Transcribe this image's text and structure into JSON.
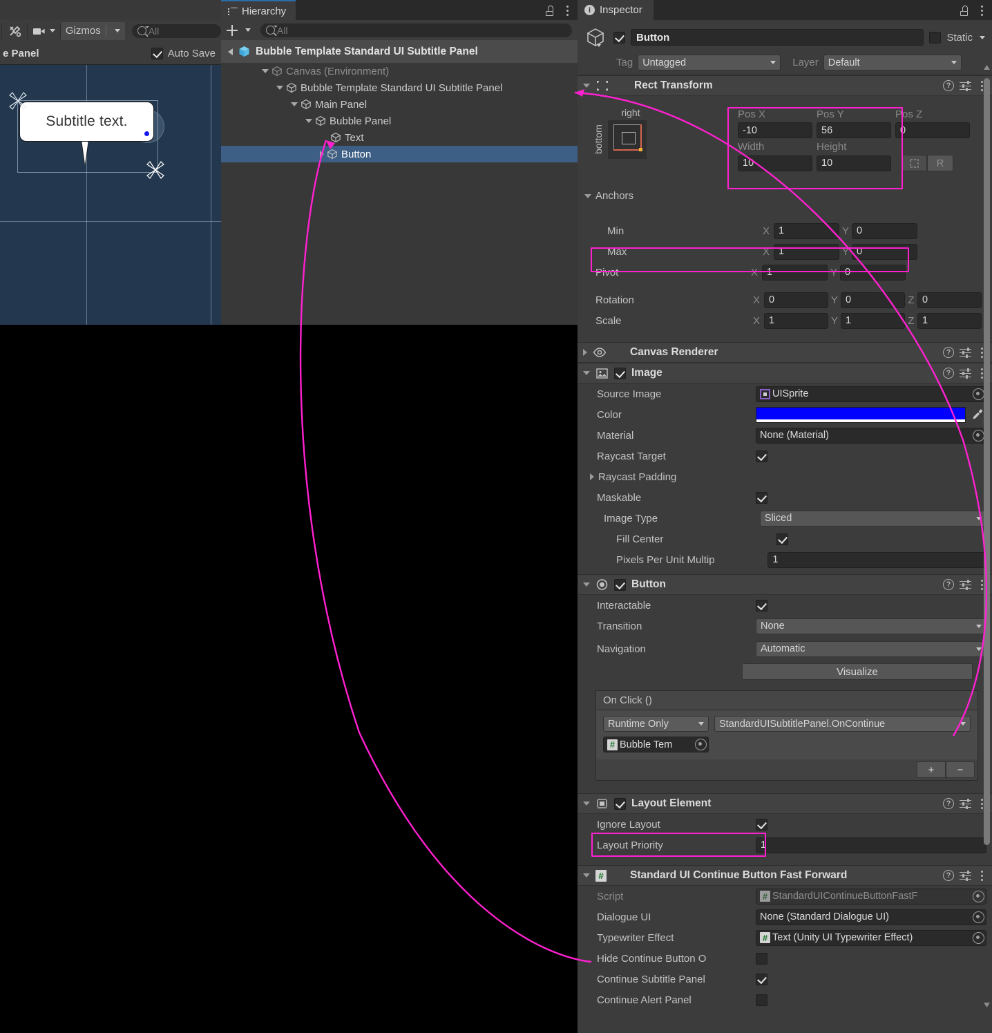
{
  "scene": {
    "toolbar": {
      "tools_icon": "tools-icon",
      "camera_icon": "camera-icon",
      "gizmos_label": "Gizmos",
      "search_placeholder": "All",
      "kebab_icon": "kebab-icon"
    },
    "breadcrumb_title": "e Panel",
    "auto_save_label": "Auto Save",
    "auto_save_checked": true,
    "bubble_text": "Subtitle text.",
    "background_color": "#23384f",
    "selection_dot_color": "#1717f0"
  },
  "hierarchy": {
    "tab_label": "Hierarchy",
    "tab_icon": "hierarchy-icon",
    "lock_icon": "lock-icon",
    "kebab_icon": "kebab-icon",
    "add_label": "+",
    "search_placeholder": "All",
    "breadcrumb": "Bubble Template Standard UI Subtitle Panel",
    "items": [
      {
        "label": "Canvas (Environment)",
        "depth": 1,
        "expanded": true,
        "dim": true,
        "selected": false,
        "arrow": "down"
      },
      {
        "label": "Bubble Template Standard UI Subtitle Panel",
        "depth": 2,
        "expanded": true,
        "dim": false,
        "selected": false,
        "arrow": "down"
      },
      {
        "label": "Main Panel",
        "depth": 3,
        "expanded": true,
        "dim": false,
        "selected": false,
        "arrow": "down"
      },
      {
        "label": "Bubble Panel",
        "depth": 4,
        "expanded": true,
        "dim": false,
        "selected": false,
        "arrow": "down"
      },
      {
        "label": "Text",
        "depth": 5,
        "expanded": false,
        "dim": false,
        "selected": false,
        "arrow": "none"
      },
      {
        "label": "Button",
        "depth": 5,
        "expanded": false,
        "dim": false,
        "selected": true,
        "arrow": "right"
      }
    ]
  },
  "inspector": {
    "tab_label": "Inspector",
    "lock_icon": "lock-icon",
    "kebab_icon": "kebab-icon",
    "object_name": "Button",
    "object_enabled": true,
    "static_label": "Static",
    "static_checked": false,
    "tag_label": "Tag",
    "tag_value": "Untagged",
    "layer_label": "Layer",
    "layer_value": "Default",
    "rect_transform": {
      "title": "Rect Transform",
      "anchor_preset_h": "right",
      "anchor_preset_v": "bottom",
      "pos_x_label": "Pos X",
      "pos_x": "-10",
      "pos_y_label": "Pos Y",
      "pos_y": "56",
      "pos_z_label": "Pos Z",
      "pos_z": "0",
      "width_label": "Width",
      "width": "10",
      "height_label": "Height",
      "height": "10",
      "blueprint_label": "",
      "raw_label": "R",
      "anchors_label": "Anchors",
      "min_label": "Min",
      "min_x": "1",
      "min_y": "0",
      "max_label": "Max",
      "max_x": "1",
      "max_y": "0",
      "pivot_label": "Pivot",
      "pivot_x": "1",
      "pivot_y": "0",
      "rotation_label": "Rotation",
      "rot_x": "0",
      "rot_y": "0",
      "rot_z": "0",
      "scale_label": "Scale",
      "scale_x": "1",
      "scale_y": "1",
      "scale_z": "1"
    },
    "canvas_renderer": {
      "title": "Canvas Renderer",
      "expanded": false
    },
    "image": {
      "title": "Image",
      "enabled": true,
      "source_image_label": "Source Image",
      "source_image_value": "UISprite",
      "color_label": "Color",
      "color_value": "#0000FF",
      "material_label": "Material",
      "material_value": "None (Material)",
      "raycast_target_label": "Raycast Target",
      "raycast_target": true,
      "raycast_padding_label": "Raycast Padding",
      "maskable_label": "Maskable",
      "maskable": true,
      "image_type_label": "Image Type",
      "image_type_value": "Sliced",
      "fill_center_label": "Fill Center",
      "fill_center": true,
      "ppu_label": "Pixels Per Unit Multip",
      "ppu_value": "1"
    },
    "button": {
      "title": "Button",
      "enabled": true,
      "interactable_label": "Interactable",
      "interactable": true,
      "transition_label": "Transition",
      "transition_value": "None",
      "navigation_label": "Navigation",
      "navigation_value": "Automatic",
      "visualize_label": "Visualize",
      "onclick_title": "On Click ()",
      "event_mode": "Runtime Only",
      "event_function": "StandardUISubtitlePanel.OnContinue",
      "event_object": "Bubble Tem",
      "add_label": "+",
      "remove_label": "−"
    },
    "layout_element": {
      "title": "Layout Element",
      "enabled": true,
      "ignore_layout_label": "Ignore Layout",
      "ignore_layout": true,
      "layout_priority_label": "Layout Priority",
      "layout_priority": "1"
    },
    "fast_forward": {
      "title": "Standard UI Continue Button Fast Forward",
      "script_label": "Script",
      "script_value": "StandardUIContinueButtonFastF",
      "dialogue_ui_label": "Dialogue UI",
      "dialogue_ui_value": "None (Standard Dialogue UI)",
      "typewriter_label": "Typewriter Effect",
      "typewriter_value": "Text (Unity UI Typewriter Effect)",
      "hide_continue_label": "Hide Continue Button O",
      "hide_continue": false,
      "continue_subtitle_label": "Continue Subtitle Panel",
      "continue_subtitle": true,
      "continue_alert_label": "Continue Alert Panel",
      "continue_alert": false
    }
  },
  "annotations": {
    "highlight_color": "#ff21d0",
    "highlighted_fields": [
      "Pos X / Pos Y / Width / Height",
      "Pivot",
      "Ignore Layout"
    ]
  }
}
